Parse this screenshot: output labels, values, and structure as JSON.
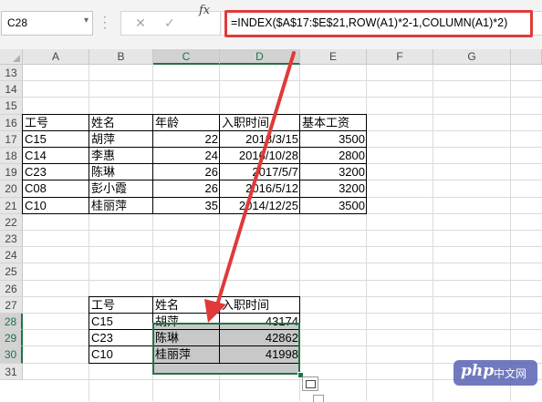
{
  "formula_bar": {
    "name_box": "C28",
    "cancel_icon": "✕",
    "enter_icon": "✓",
    "fx_label": "fx",
    "formula": "=INDEX($A$17:$E$21,ROW(A1)*2-1,COLUMN(A1)*2)"
  },
  "columns": [
    "A",
    "B",
    "C",
    "D",
    "E",
    "F",
    "G"
  ],
  "rows": [
    "13",
    "14",
    "15",
    "16",
    "17",
    "18",
    "19",
    "20",
    "21",
    "22",
    "23",
    "24",
    "25",
    "26",
    "27",
    "28",
    "29",
    "30",
    "31"
  ],
  "source_table": {
    "headers": [
      "工号",
      "姓名",
      "年龄",
      "入职时间",
      "基本工资"
    ],
    "rows": [
      [
        "C15",
        "胡萍",
        "22",
        "2018/3/15",
        "3500"
      ],
      [
        "C14",
        "李惠",
        "24",
        "2016/10/28",
        "2800"
      ],
      [
        "C23",
        "陈琳",
        "26",
        "2017/5/7",
        "3200"
      ],
      [
        "C08",
        "彭小霞",
        "26",
        "2016/5/12",
        "3200"
      ],
      [
        "C10",
        "桂丽萍",
        "35",
        "2014/12/25",
        "3500"
      ]
    ]
  },
  "result_table": {
    "headers": [
      "工号",
      "姓名",
      "入职时间"
    ],
    "rows": [
      [
        "C15",
        "胡萍",
        "43174"
      ],
      [
        "C23",
        "陈琳",
        "42862"
      ],
      [
        "C10",
        "桂丽萍",
        "41998"
      ]
    ]
  },
  "watermark": {
    "brand": "php",
    "sub": "中文网"
  },
  "colors": {
    "annotation_red": "#e03a3a",
    "excel_green": "#217346",
    "selection_gray": "#c8c8c8"
  }
}
